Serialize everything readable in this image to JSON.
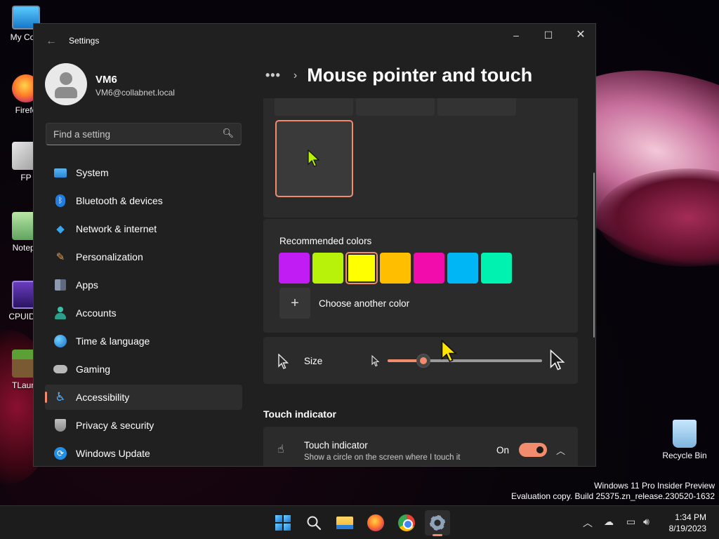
{
  "desktop": {
    "icons": [
      {
        "label": "My Com"
      },
      {
        "label": "Firefo"
      },
      {
        "label": "FP"
      },
      {
        "label": "Notepa"
      },
      {
        "label": "CPUID C"
      },
      {
        "label": "TLaunc"
      },
      {
        "label": "Recycle Bin"
      }
    ],
    "watermark": {
      "line1": "Windows 11 Pro Insider Preview",
      "line2": "Evaluation copy. Build 25375.zn_release.230520-1632"
    }
  },
  "window": {
    "title": "Settings",
    "controls": {
      "minimize": "–",
      "maximize": "☐",
      "close": "✕"
    }
  },
  "profile": {
    "name": "VM6",
    "email": "VM6@collabnet.local"
  },
  "search": {
    "placeholder": "Find a setting",
    "value": ""
  },
  "sidebar": {
    "items": [
      {
        "label": "System",
        "icon": "system-icon"
      },
      {
        "label": "Bluetooth & devices",
        "icon": "bluetooth-icon"
      },
      {
        "label": "Network & internet",
        "icon": "network-icon"
      },
      {
        "label": "Personalization",
        "icon": "brush-icon"
      },
      {
        "label": "Apps",
        "icon": "apps-icon"
      },
      {
        "label": "Accounts",
        "icon": "accounts-icon"
      },
      {
        "label": "Time & language",
        "icon": "globe-icon"
      },
      {
        "label": "Gaming",
        "icon": "gamepad-icon"
      },
      {
        "label": "Accessibility",
        "icon": "accessibility-icon",
        "active": true
      },
      {
        "label": "Privacy & security",
        "icon": "shield-icon"
      },
      {
        "label": "Windows Update",
        "icon": "update-icon"
      }
    ]
  },
  "header": {
    "more": "•••",
    "title": "Mouse pointer and touch"
  },
  "colors": {
    "label": "Recommended colors",
    "swatches": [
      "#c21cf5",
      "#b8f10a",
      "#ffff00",
      "#ffbe00",
      "#f20cac",
      "#00b6f5",
      "#00f2b0"
    ],
    "selected_index": 2,
    "choose_label": "Choose another color",
    "accent": "#f28c6c"
  },
  "size": {
    "label": "Size",
    "value_fraction": 0.23
  },
  "touch": {
    "section": "Touch indicator",
    "title": "Touch indicator",
    "description": "Show a circle on the screen where I touch it",
    "state": "On"
  },
  "taskbar": {
    "apps": [
      "start-icon",
      "search-icon",
      "file-explorer-icon",
      "firefox-icon",
      "chrome-icon",
      "settings-icon"
    ],
    "time": "1:34 PM",
    "date": "8/19/2023"
  }
}
